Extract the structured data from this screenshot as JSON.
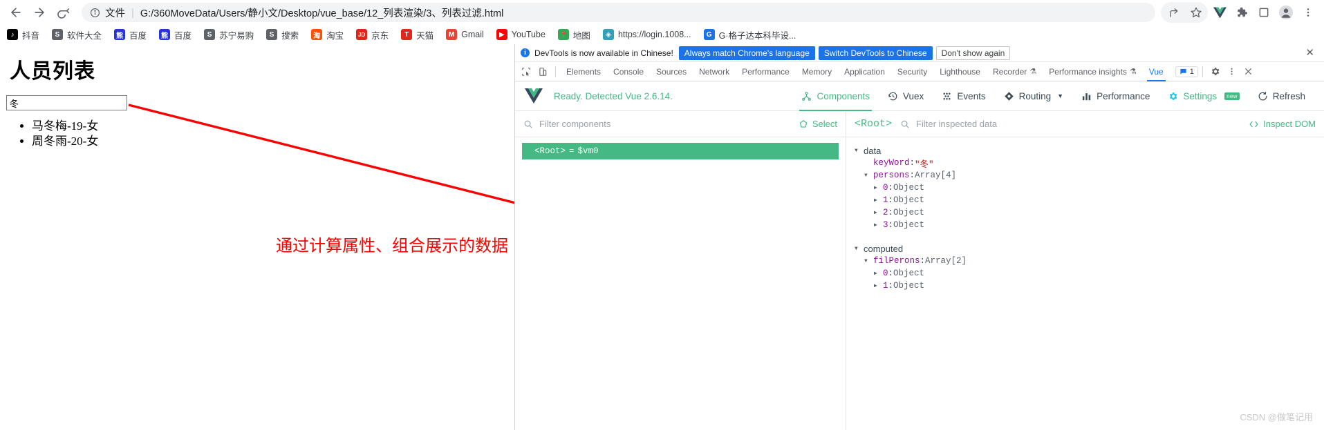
{
  "browser": {
    "nav": {
      "back_icon": "arrow-left-icon",
      "forward_icon": "arrow-right-icon",
      "reload_icon": "reload-icon"
    },
    "omnibox": {
      "info_icon": "info-circle-icon",
      "scheme_label": "文件",
      "url": "G:/360MoveData/Users/静小文/Desktop/vue_base/12_列表渲染/3、列表过滤.html"
    },
    "toolbar_icons": [
      {
        "name": "share-icon",
        "glyph": "share"
      },
      {
        "name": "bookmark-star-icon",
        "glyph": "star"
      },
      {
        "name": "vue-devtools-extension-icon",
        "glyph": "vue"
      },
      {
        "name": "extensions-puzzle-icon",
        "glyph": "puzzle"
      },
      {
        "name": "sidepanel-icon",
        "glyph": "square"
      },
      {
        "name": "profile-avatar-icon",
        "glyph": "person"
      },
      {
        "name": "chrome-menu-icon",
        "glyph": "kebab"
      }
    ],
    "bookmarks": [
      {
        "label": "抖音",
        "icon": "douyin-icon",
        "color": "#000000",
        "glyph": "♪"
      },
      {
        "label": "软件大全",
        "icon": "globe-icon",
        "color": "#5f6368",
        "glyph": "S"
      },
      {
        "label": "百度",
        "icon": "baidu-icon",
        "color": "#2932e1",
        "glyph": "熊"
      },
      {
        "label": "百度",
        "icon": "baidu-icon",
        "color": "#2932e1",
        "glyph": "熊"
      },
      {
        "label": "苏宁易购",
        "icon": "globe-icon",
        "color": "#5f6368",
        "glyph": "S"
      },
      {
        "label": "搜索",
        "icon": "globe-icon",
        "color": "#5f6368",
        "glyph": "S"
      },
      {
        "label": "淘宝",
        "icon": "taobao-icon",
        "color": "#ff5000",
        "glyph": "淘"
      },
      {
        "label": "京东",
        "icon": "jd-icon",
        "color": "#e1251b",
        "glyph": "JD"
      },
      {
        "label": "天猫",
        "icon": "tmall-icon",
        "color": "#e1251b",
        "glyph": "T"
      },
      {
        "label": "Gmail",
        "icon": "gmail-icon",
        "color": "#ea4335",
        "glyph": "M"
      },
      {
        "label": "YouTube",
        "icon": "youtube-icon",
        "color": "#ff0000",
        "glyph": "▶"
      },
      {
        "label": "地图",
        "icon": "maps-pin-icon",
        "color": "#34a853",
        "glyph": "📍"
      },
      {
        "label": "https://login.1008...",
        "icon": "globe-icon",
        "color": "#34a0b8",
        "glyph": "◈"
      },
      {
        "label": "G·格子达本科毕设...",
        "icon": "globe-icon",
        "color": "#1a73e8",
        "glyph": "G"
      }
    ]
  },
  "page": {
    "title": "人员列表",
    "search": {
      "value": "冬",
      "placeholder": ""
    },
    "list_items": [
      "马冬梅-19-女",
      "周冬雨-20-女"
    ],
    "annotation": "通过计算属性、组合展示的数据",
    "annotation_color": "#ff0000",
    "arrow_color": "#ff0000"
  },
  "devtools": {
    "banner": {
      "icon": "info-circle-icon",
      "message": "DevTools is now available in Chinese!",
      "primary_button": "Always match Chrome's language",
      "secondary_button": "Switch DevTools to Chinese",
      "dismiss_button": "Don't show again",
      "close_icon": "close-icon"
    },
    "tool_icons": [
      {
        "name": "inspect-element-icon"
      },
      {
        "name": "device-toolbar-icon"
      }
    ],
    "tabs": [
      {
        "label": "Elements",
        "active": false,
        "flask": false
      },
      {
        "label": "Console",
        "active": false,
        "flask": false
      },
      {
        "label": "Sources",
        "active": false,
        "flask": false
      },
      {
        "label": "Network",
        "active": false,
        "flask": false
      },
      {
        "label": "Performance",
        "active": false,
        "flask": false
      },
      {
        "label": "Memory",
        "active": false,
        "flask": false
      },
      {
        "label": "Application",
        "active": false,
        "flask": false
      },
      {
        "label": "Security",
        "active": false,
        "flask": false
      },
      {
        "label": "Lighthouse",
        "active": false,
        "flask": false
      },
      {
        "label": "Recorder",
        "active": false,
        "flask": true
      },
      {
        "label": "Performance insights",
        "active": false,
        "flask": true
      },
      {
        "label": "Vue",
        "active": true,
        "flask": false
      }
    ],
    "issues_badge": {
      "icon": "message-icon",
      "count": "1"
    },
    "settings_icon": "gear-icon",
    "more_icon": "kebab-icon",
    "close_icon": "close-icon"
  },
  "vue_panel": {
    "logo_icon": "vue-logo-icon",
    "status": "Ready. Detected Vue 2.6.14.",
    "accent_color": "#42b983",
    "nav": [
      {
        "label": "Components",
        "icon": "components-icon",
        "active": true,
        "dim": false,
        "caret": false,
        "badge": ""
      },
      {
        "label": "Vuex",
        "icon": "history-icon",
        "active": false,
        "dim": true,
        "caret": false,
        "badge": ""
      },
      {
        "label": "Events",
        "icon": "events-icon",
        "active": false,
        "dim": true,
        "caret": false,
        "badge": ""
      },
      {
        "label": "Routing",
        "icon": "routing-icon",
        "active": false,
        "dim": true,
        "caret": true,
        "badge": ""
      },
      {
        "label": "Performance",
        "icon": "performance-icon",
        "active": false,
        "dim": true,
        "caret": false,
        "badge": ""
      },
      {
        "label": "Settings",
        "icon": "settings-icon",
        "active": false,
        "dim": false,
        "caret": false,
        "badge": "new"
      },
      {
        "label": "Refresh",
        "icon": "refresh-icon",
        "active": false,
        "dim": true,
        "caret": false,
        "badge": ""
      }
    ],
    "components": {
      "filter_placeholder": "Filter components",
      "search_icon": "search-icon",
      "select_label": "Select",
      "select_icon": "target-icon",
      "tree": [
        {
          "name": "<Root>",
          "eq": "=",
          "vm": "$vm0",
          "selected": true
        }
      ]
    },
    "inspector": {
      "root_label": "<Root>",
      "search_icon": "search-icon",
      "filter_placeholder": "Filter inspected data",
      "inspect_dom_label": "Inspect DOM",
      "inspect_dom_icon": "code-brackets-icon",
      "groups": [
        {
          "name": "data",
          "expanded": true,
          "rows": [
            {
              "indent": 1,
              "caret": "none",
              "key": "keyWord",
              "value": "\"冬\"",
              "value_kind": "string"
            },
            {
              "indent": 1,
              "caret": "down",
              "key": "persons",
              "value": "Array[4]",
              "value_kind": "type"
            },
            {
              "indent": 2,
              "caret": "right",
              "key": "0",
              "value": "Object",
              "value_kind": "type"
            },
            {
              "indent": 2,
              "caret": "right",
              "key": "1",
              "value": "Object",
              "value_kind": "type"
            },
            {
              "indent": 2,
              "caret": "right",
              "key": "2",
              "value": "Object",
              "value_kind": "type"
            },
            {
              "indent": 2,
              "caret": "right",
              "key": "3",
              "value": "Object",
              "value_kind": "type"
            }
          ]
        },
        {
          "name": "computed",
          "expanded": true,
          "rows": [
            {
              "indent": 1,
              "caret": "down",
              "key": "filPerons",
              "value": "Array[2]",
              "value_kind": "type"
            },
            {
              "indent": 2,
              "caret": "right",
              "key": "0",
              "value": "Object",
              "value_kind": "type"
            },
            {
              "indent": 2,
              "caret": "right",
              "key": "1",
              "value": "Object",
              "value_kind": "type"
            }
          ]
        }
      ]
    }
  },
  "watermark": "CSDN @做笔记用"
}
